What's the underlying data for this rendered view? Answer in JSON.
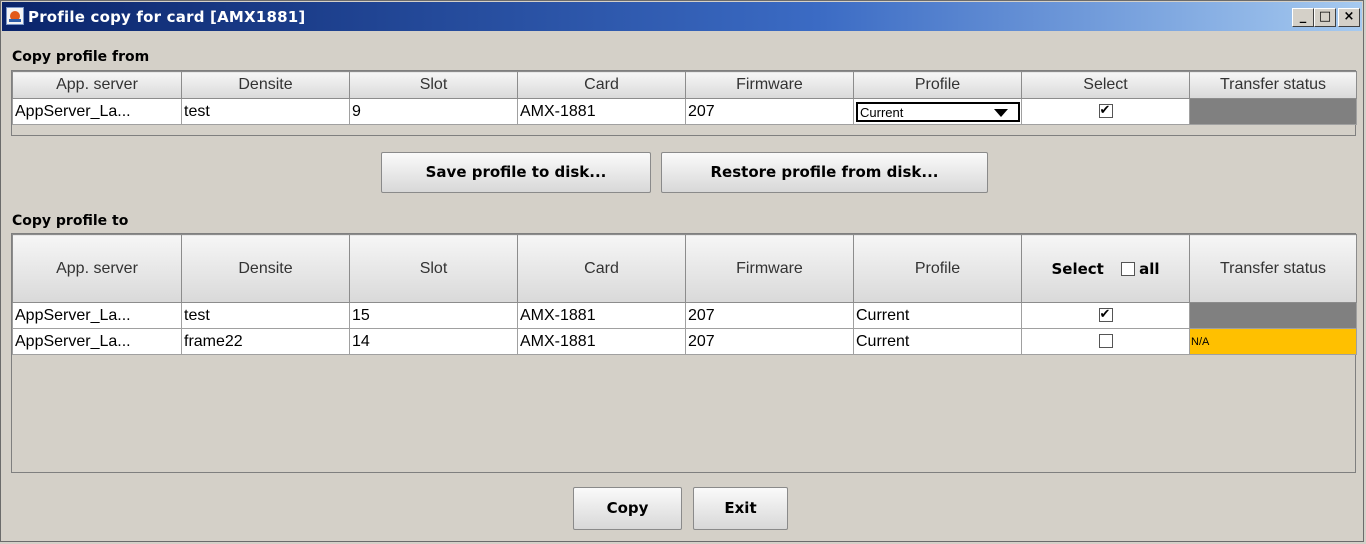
{
  "window": {
    "title": "Profile copy for card [AMX1881]",
    "controls": {
      "minimize": "_",
      "maximize": "□",
      "close": "×"
    }
  },
  "from_section": {
    "label": "Copy profile from",
    "columns": [
      "App. server",
      "Densite",
      "Slot",
      "Card",
      "Firmware",
      "Profile",
      "Select",
      "Transfer status"
    ],
    "row": {
      "app_server": "AppServer_La...",
      "densite": "test",
      "slot": "9",
      "card": "AMX-1881",
      "firmware": "207",
      "profile": "Current",
      "selected": true,
      "transfer_status": "",
      "transfer_color": "#808080"
    }
  },
  "disk_buttons": {
    "save": "Save profile to disk...",
    "restore": "Restore profile from disk..."
  },
  "to_section": {
    "label": "Copy profile to",
    "columns": [
      "App. server",
      "Densite",
      "Slot",
      "Card",
      "Firmware",
      "Profile"
    ],
    "select_header": {
      "label": "Select",
      "all_label": "all",
      "all_checked": false
    },
    "status_header": "Transfer status",
    "rows": [
      {
        "app_server": "AppServer_La...",
        "densite": "test",
        "slot": "15",
        "card": "AMX-1881",
        "firmware": "207",
        "profile": "Current",
        "selected": true,
        "transfer_status": "",
        "transfer_color": "#808080"
      },
      {
        "app_server": "AppServer_La...",
        "densite": "frame22",
        "slot": "14",
        "card": "AMX-1881",
        "firmware": "207",
        "profile": "Current",
        "selected": false,
        "transfer_status": "N/A",
        "transfer_color": "#ffc000"
      }
    ]
  },
  "bottom_buttons": {
    "copy": "Copy",
    "exit": "Exit"
  }
}
